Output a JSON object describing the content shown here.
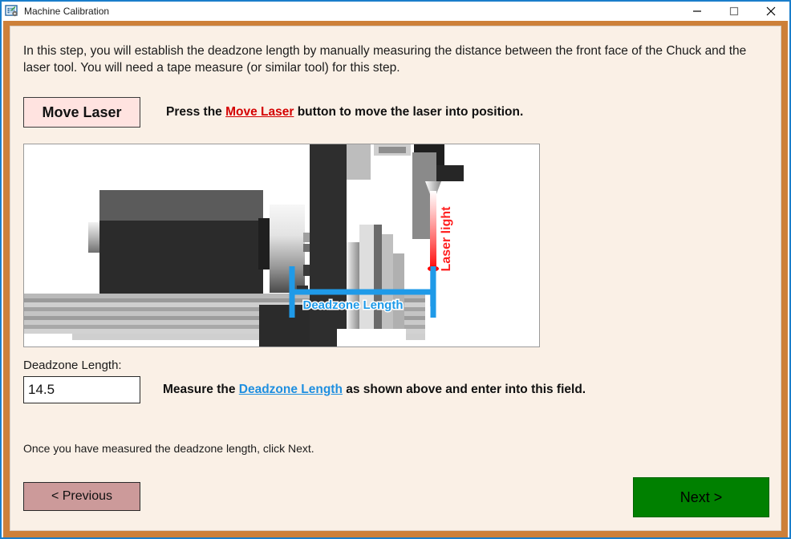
{
  "window": {
    "title": "Machine Calibration",
    "icon": "calibration-settings-icon",
    "controls": {
      "minimize": "minimize-icon",
      "maximize": "maximize-icon",
      "close": "close-icon"
    },
    "colors": {
      "title_border": "#1a7ecb",
      "frame": "#cd8039",
      "content_bg": "#faf0e6"
    }
  },
  "instructions": {
    "intro": "In this step, you will establish the deadzone length by manually measuring the distance between the front face of the Chuck and the laser tool. You will need a tape measure (or similar tool) for this step.",
    "closing": "Once you have measured the deadzone length, click Next."
  },
  "move_laser": {
    "button_label": "Move Laser",
    "hint_before": "Press the",
    "hint_link": "Move Laser",
    "hint_after": "button to move the laser into position.",
    "link_color": "#d40000",
    "button_bg": "#ffe3e0"
  },
  "diagram": {
    "laser_label": "Laser light",
    "laser_color": "#ff1a1a",
    "deadzone_label": "Deadzone Length",
    "deadzone_color": "#1f9ae8"
  },
  "deadzone_field": {
    "label": "Deadzone Length:",
    "value": "14.5",
    "placeholder": "",
    "hint_before": "Measure the",
    "hint_link": "Deadzone Length",
    "hint_after": "as shown above and enter into this field.",
    "link_color": "#1f8fe0"
  },
  "navigation": {
    "previous_label": "< Previous",
    "previous_bg": "#cc9a9a",
    "next_label": "Next >",
    "next_bg": "#008000"
  }
}
